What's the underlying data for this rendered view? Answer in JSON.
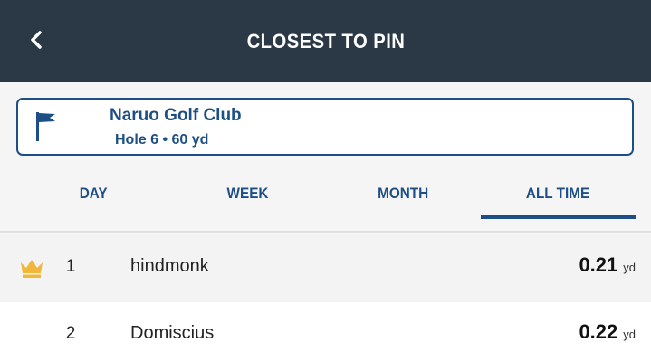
{
  "header": {
    "title": "CLOSEST TO PIN"
  },
  "course": {
    "name": "Naruo Golf Club",
    "hole_info": "Hole 6 • 60 yd"
  },
  "tabs": [
    {
      "label": "DAY",
      "active": false
    },
    {
      "label": "WEEK",
      "active": false
    },
    {
      "label": "MONTH",
      "active": false
    },
    {
      "label": "ALL TIME",
      "active": true
    }
  ],
  "leaderboard": [
    {
      "rank": "1",
      "player": "hindmonk",
      "distance": "0.21",
      "unit": "yd",
      "leader": true
    },
    {
      "rank": "2",
      "player": "Domiscius",
      "distance": "0.22",
      "unit": "yd",
      "leader": false
    }
  ],
  "colors": {
    "header_bg": "#2b3846",
    "accent": "#1d4f86",
    "crown": "#f0b73a"
  },
  "icons": {
    "back": "chevron-left-icon",
    "flag": "flag-icon",
    "leader": "crown-icon"
  }
}
